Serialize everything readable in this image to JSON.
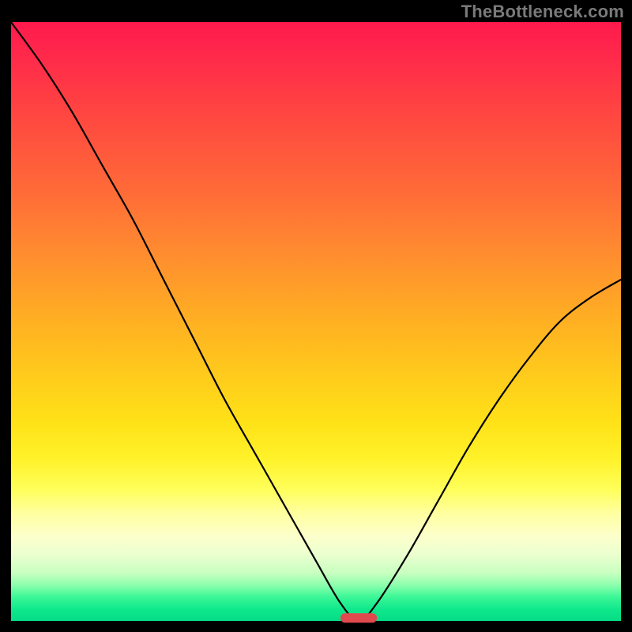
{
  "watermark": "TheBottleneck.com",
  "colors": {
    "curve": "#000000",
    "marker": "#e04a4e",
    "background": "#000000"
  },
  "chart_data": {
    "type": "line",
    "title": "",
    "xlabel": "",
    "ylabel": "",
    "xlim": [
      0,
      100
    ],
    "ylim": [
      0,
      100
    ],
    "note": "V-shaped bottleneck curve on a vertical youpi gradient (red high → green low). Minimum at x≈57. Values estimated from pixel positions; axes are unitless 0–100.",
    "series": [
      {
        "name": "bottleneck-curve",
        "x": [
          0,
          5,
          10,
          15,
          20,
          25,
          30,
          35,
          40,
          45,
          50,
          54,
          57,
          60,
          65,
          70,
          75,
          80,
          85,
          90,
          95,
          100
        ],
        "y": [
          100,
          93,
          85,
          76,
          67,
          57,
          47,
          37,
          28,
          19,
          10,
          3,
          0,
          3,
          11,
          20,
          29,
          37,
          44,
          50,
          54,
          57
        ]
      }
    ],
    "marker": {
      "name": "minimum",
      "x_center": 57,
      "x_span": [
        54,
        60
      ],
      "y": 0.5
    },
    "background_gradient_stops": [
      {
        "pos": 0.0,
        "color": "#ff1a4d"
      },
      {
        "pos": 0.3,
        "color": "#ff7a34"
      },
      {
        "pos": 0.6,
        "color": "#ffd21c"
      },
      {
        "pos": 0.8,
        "color": "#ffff80"
      },
      {
        "pos": 0.92,
        "color": "#b8ffb8"
      },
      {
        "pos": 1.0,
        "color": "#05dc86"
      }
    ]
  }
}
